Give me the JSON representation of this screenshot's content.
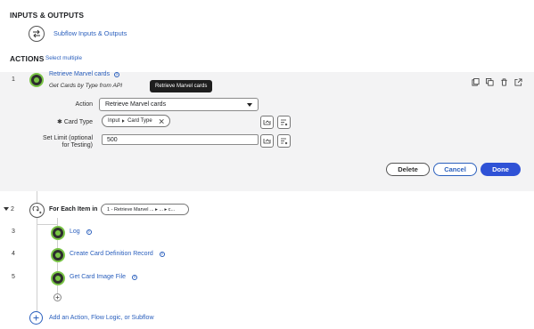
{
  "inputs_outputs": {
    "title": "INPUTS & OUTPUTS",
    "subflow_link": "Subflow Inputs & Outputs",
    "icon": "swap-arrows-icon"
  },
  "actions": {
    "title": "ACTIONS",
    "select_multiple": "Select multiple"
  },
  "steps": [
    {
      "num": "1",
      "label": "Retrieve Marvel cards",
      "subtitle": "Get Cards by Type from API",
      "tooltip": "Retrieve Marvel cards"
    },
    {
      "num": "2",
      "label": "For Each Item in",
      "pill": "1 - Retrieve Marvel ...  ▸  ...  ▸  c..."
    },
    {
      "num": "3",
      "label": "Log"
    },
    {
      "num": "4",
      "label": "Create Card Definition Record"
    },
    {
      "num": "5",
      "label": "Get Card Image File"
    }
  ],
  "form": {
    "action_label": "Action",
    "action_value": "Retrieve Marvel cards",
    "card_type_label": "Card Type",
    "card_type_required": "✱",
    "card_type_pill": {
      "part1": "Input",
      "part2": "Card Type"
    },
    "set_limit_label_line1": "Set Limit (optional",
    "set_limit_label_line2": "for Testing)",
    "set_limit_value": "500"
  },
  "buttons": {
    "delete": "Delete",
    "cancel": "Cancel",
    "done": "Done"
  },
  "add_action": "Add an Action, Flow Logic, or Subflow",
  "colors": {
    "link": "#2a5fbd",
    "primary": "#2f52d6",
    "badge_green": "#79c545",
    "expanded_bg": "#f3f3f4"
  }
}
